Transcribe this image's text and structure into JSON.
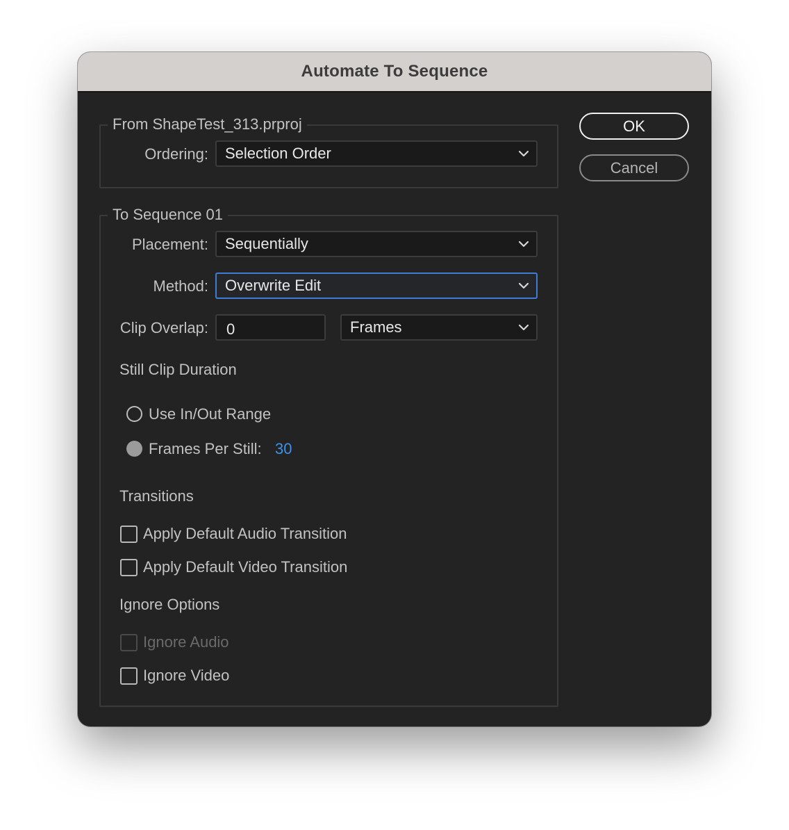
{
  "dialog": {
    "title": "Automate To Sequence"
  },
  "buttons": {
    "ok": "OK",
    "cancel": "Cancel"
  },
  "from_group": {
    "legend": "From ShapeTest_313.prproj",
    "ordering_label": "Ordering:",
    "ordering_value": "Selection Order"
  },
  "to_group": {
    "legend": "To Sequence 01",
    "placement_label": "Placement:",
    "placement_value": "Sequentially",
    "method_label": "Method:",
    "method_value": "Overwrite Edit",
    "clip_overlap_label": "Clip Overlap:",
    "clip_overlap_value": "0",
    "clip_overlap_unit": "Frames",
    "still_clip_duration_heading": "Still Clip Duration",
    "use_in_out_label": "Use In/Out Range",
    "use_in_out_selected": false,
    "frames_per_still_label": "Frames Per Still:",
    "frames_per_still_value": "30",
    "frames_per_still_selected": true,
    "transitions_heading": "Transitions",
    "apply_audio_transition_label": "Apply Default Audio Transition",
    "apply_audio_transition_checked": false,
    "apply_video_transition_label": "Apply Default Video Transition",
    "apply_video_transition_checked": false,
    "ignore_options_heading": "Ignore Options",
    "ignore_audio_label": "Ignore Audio",
    "ignore_audio_checked": false,
    "ignore_audio_disabled": true,
    "ignore_video_label": "Ignore Video",
    "ignore_video_checked": false
  },
  "icons": {
    "dropdown": "chevron-down-icon"
  },
  "colors": {
    "title_bar": "#d4d0cd",
    "dialog_background": "#232323",
    "focus_ring": "#3f7cd4",
    "value_link": "#3e92e8"
  }
}
